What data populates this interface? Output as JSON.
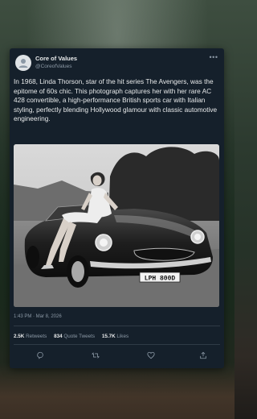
{
  "tweet": {
    "display_name": "Core of Values",
    "handle": "@CoreofValues",
    "more_icon": "more-horizontal-icon",
    "text": "In 1968, Linda Thorson, star of the hit series The Avengers, was the epitome of 60s chic. This photograph captures her with her rare AC 428 convertible, a high-performance British sports car with Italian styling, perfectly blending Hollywood glamour with classic automotive engineering.",
    "photo": {
      "license_plate": "LPH 800D"
    },
    "timestamp": "1:43 PM · Mar 8, 2026",
    "stats": {
      "retweets_count": "2.5K",
      "retweets_label": "Retweets",
      "quotes_count": "834",
      "quotes_label": "Quote Tweets",
      "likes_count": "15.7K",
      "likes_label": "Likes"
    },
    "actions": [
      "reply-icon",
      "retweet-icon",
      "like-icon",
      "share-icon"
    ]
  },
  "colors": {
    "card_bg": "#15202b",
    "primary_text": "#e7e9ea",
    "secondary_text": "#8b98a5",
    "divider": "#2f3b46"
  }
}
